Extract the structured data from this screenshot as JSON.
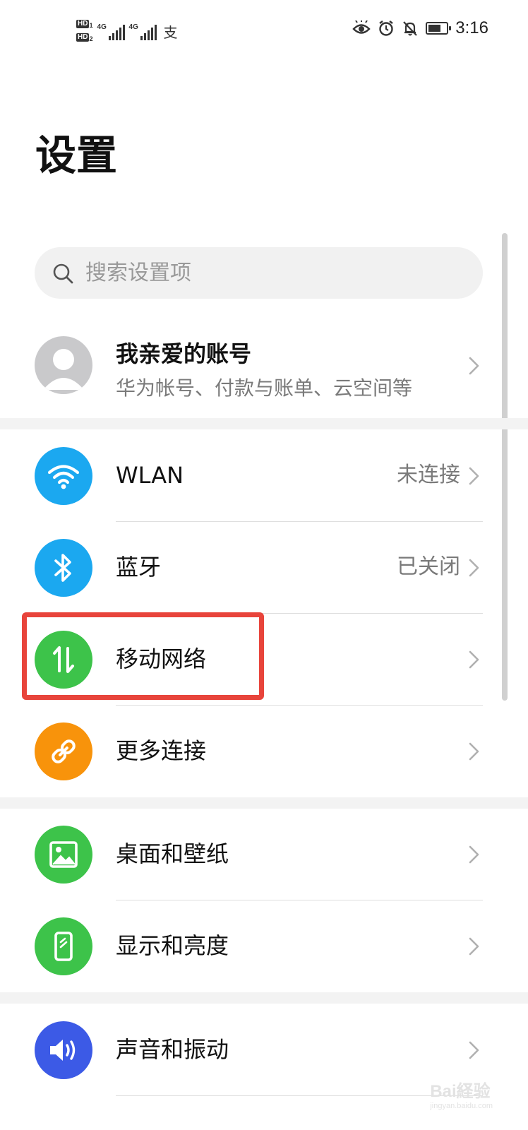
{
  "status_bar": {
    "sim1_label": "HD",
    "sim1_index": "1",
    "sim2_label": "HD",
    "sim2_index": "2",
    "signal1_type": "4G",
    "signal2_type": "4G",
    "pay_icon": "alipay-icon",
    "eye_icon": "eye-comfort-icon",
    "alarm_icon": "alarm-icon",
    "mute_icon": "bell-off-icon",
    "battery_level": 0.6,
    "time": "3:16"
  },
  "page": {
    "title": "设置"
  },
  "search": {
    "placeholder": "搜索设置项",
    "icon": "search-icon"
  },
  "account": {
    "name": "我亲爱的账号",
    "subtitle": "华为帐号、付款与账单、云空间等",
    "icon": "avatar-icon"
  },
  "groups": [
    {
      "items": [
        {
          "label": "WLAN",
          "value": "未连接",
          "icon": "wifi-icon",
          "color": "#1ba8f0"
        },
        {
          "label": "蓝牙",
          "value": "已关闭",
          "icon": "bluetooth-icon",
          "color": "#1ba8f0"
        },
        {
          "label": "移动网络",
          "value": "",
          "icon": "mobile-data-icon",
          "color": "#3dc34a"
        },
        {
          "label": "更多连接",
          "value": "",
          "icon": "link-icon",
          "color": "#f8930b"
        }
      ]
    },
    {
      "items": [
        {
          "label": "桌面和壁纸",
          "value": "",
          "icon": "wallpaper-icon",
          "color": "#3dc34a"
        },
        {
          "label": "显示和亮度",
          "value": "",
          "icon": "display-icon",
          "color": "#3dc34a"
        }
      ]
    },
    {
      "items": [
        {
          "label": "声音和振动",
          "value": "",
          "icon": "volume-icon",
          "color": "#3c5ae6"
        }
      ]
    }
  ],
  "watermark": {
    "brand": "Bai経验",
    "url": "jingyan.baidu.com"
  },
  "colors": {
    "highlight": "#e8443b",
    "background": "#ffffff",
    "band": "#f3f3f3"
  }
}
